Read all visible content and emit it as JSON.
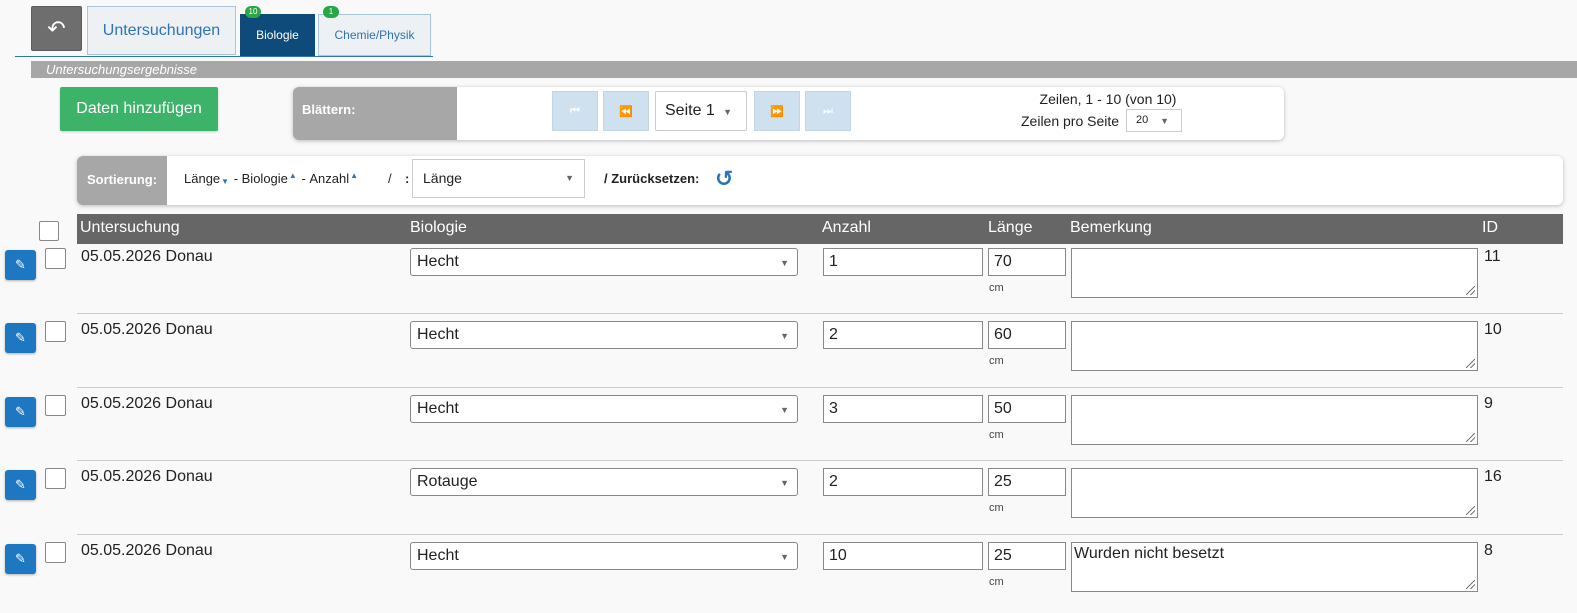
{
  "tabs": {
    "back_icon": "back-arrow-icon",
    "main": "Untersuchungen",
    "biologie": {
      "label": "Biologie",
      "badge": "10"
    },
    "chemie": {
      "label": "Chemie/Physik",
      "badge": "1"
    }
  },
  "section_title": "Untersuchungsergebnisse",
  "add_button": "Daten hinzufügen",
  "pager": {
    "label": "Blättern:",
    "page": "Seite 1",
    "rows_info": "Zeilen, 1 - 10 (von 10)",
    "rows_per_page_label": "Zeilen pro Seite",
    "rows_per_page": "20"
  },
  "sort": {
    "label": "Sortierung:",
    "chain": [
      "Länge",
      "Biologie",
      "Anzahl"
    ],
    "slash": "/",
    "colon": ":",
    "selected": "Länge",
    "reset": "/ Zurücksetzen:"
  },
  "table": {
    "columns": [
      "Untersuchung",
      "Biologie",
      "Anzahl",
      "Länge",
      "Bemerkung",
      "ID"
    ],
    "unit": "cm",
    "rows": [
      {
        "untersuchung": "05.05.2026 Donau",
        "biologie": "Hecht",
        "anzahl": "1",
        "laenge": "70",
        "bemerkung": "",
        "id": "11"
      },
      {
        "untersuchung": "05.05.2026 Donau",
        "biologie": "Hecht",
        "anzahl": "2",
        "laenge": "60",
        "bemerkung": "",
        "id": "10"
      },
      {
        "untersuchung": "05.05.2026 Donau",
        "biologie": "Hecht",
        "anzahl": "3",
        "laenge": "50",
        "bemerkung": "",
        "id": "9"
      },
      {
        "untersuchung": "05.05.2026 Donau",
        "biologie": "Rotauge",
        "anzahl": "2",
        "laenge": "25",
        "bemerkung": "",
        "id": "16"
      },
      {
        "untersuchung": "05.05.2026 Donau",
        "biologie": "Hecht",
        "anzahl": "10",
        "laenge": "25",
        "bemerkung": "Wurden nicht besetzt",
        "id": "8"
      }
    ]
  },
  "colors": {
    "accent": "#2f73b5",
    "active_tab": "#0f4b7a",
    "add": "#3db36a",
    "header": "#666666"
  }
}
